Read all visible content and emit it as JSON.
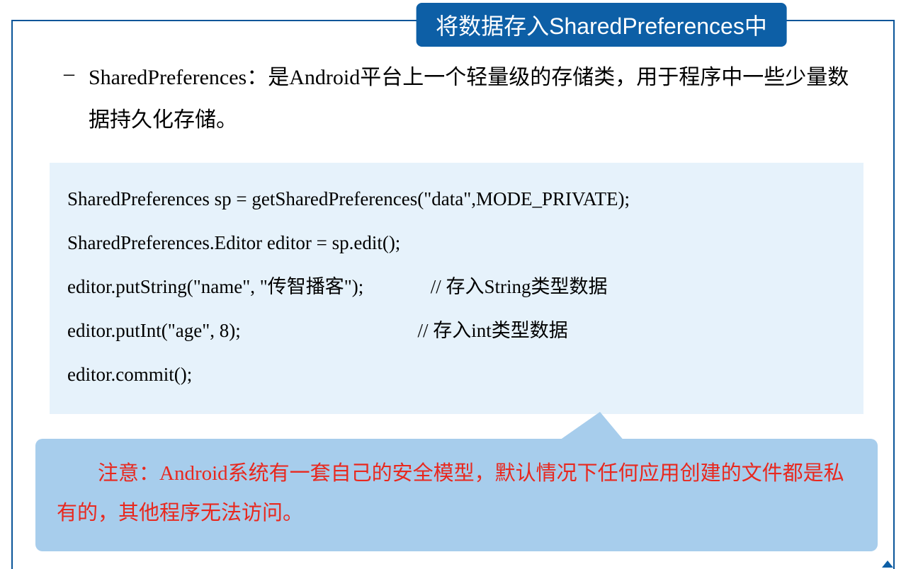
{
  "title": "将数据存入SharedPreferences中",
  "bullet_marker": "–",
  "intro": "SharedPreferences：是Android平台上一个轻量级的存储类，用于程序中一些少量数据持久化存储。",
  "code": {
    "line1": "SharedPreferences sp = getSharedPreferences(\"data\",MODE_PRIVATE);",
    "line2": "SharedPreferences.Editor editor = sp.edit();",
    "line3": "editor.putString(\"name\", \"传智播客\");              // 存入String类型数据",
    "line4": "editor.putInt(\"age\", 8);                                     // 存入int类型数据",
    "line5": "editor.commit();"
  },
  "callout": "注意：Android系统有一套自己的安全模型，默认情况下任何应用创建的文件都是私有的，其他程序无法访问。"
}
